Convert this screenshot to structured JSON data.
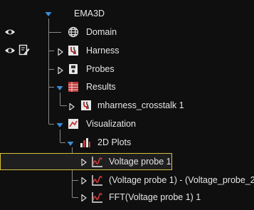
{
  "tree": {
    "root": {
      "label": "EMA3D"
    },
    "domain": {
      "label": "Domain"
    },
    "harness": {
      "label": "Harness"
    },
    "probes": {
      "label": "Probes"
    },
    "results": {
      "label": "Results",
      "children": [
        {
          "label": "mharness_crosstalk 1"
        }
      ]
    },
    "visualization": {
      "label": "Visualization"
    },
    "plots2d": {
      "label": "2D Plots",
      "children": [
        {
          "label": "Voltage probe 1",
          "selected": true
        },
        {
          "label": "(Voltage probe 1) - (Voltage_probe_2)"
        },
        {
          "label": "FFT(Voltage probe 1) 1"
        }
      ]
    }
  },
  "colors": {
    "accent": "#3a8fd8",
    "selection": "#d9bf3a",
    "background": "#0f0f10"
  }
}
